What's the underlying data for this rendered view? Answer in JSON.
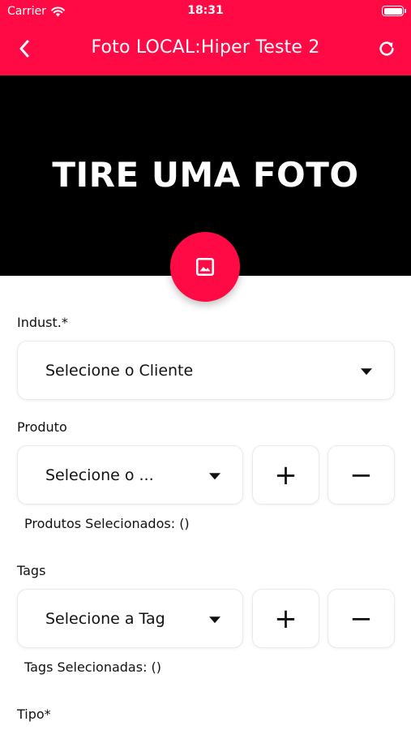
{
  "status_bar": {
    "carrier": "Carrier",
    "time": "18:31"
  },
  "nav": {
    "title": "Foto LOCAL:Hiper Teste 2",
    "back_icon": "chevron-left-icon",
    "refresh_icon": "refresh-icon"
  },
  "photo": {
    "placeholder_text": "TIRE UMA FOTO",
    "button_icon": "image-icon"
  },
  "form": {
    "industria": {
      "label": "Indust.*",
      "value": "Selecione o Cliente"
    },
    "produto": {
      "label": "Produto",
      "value": "Selecione o ...",
      "add_label": "+",
      "remove_label": "−",
      "selected_text": "Produtos Selecionados: ()"
    },
    "tags": {
      "label": "Tags",
      "value": "Selecione a Tag",
      "add_label": "+",
      "remove_label": "−",
      "selected_text": "Tags Selecionadas: ()"
    },
    "tipo": {
      "label": "Tipo*"
    }
  },
  "colors": {
    "accent": "#ff0a45",
    "photo_background": "#000000"
  }
}
